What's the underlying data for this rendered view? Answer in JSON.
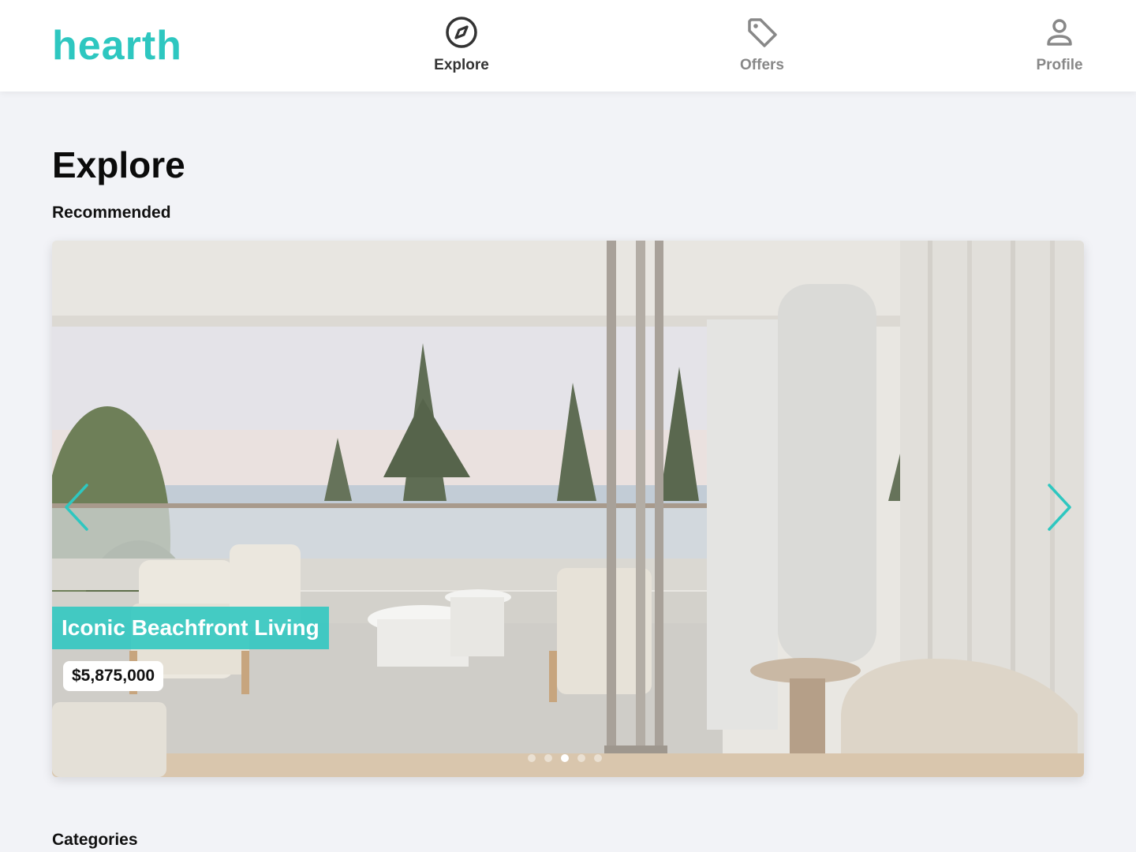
{
  "header": {
    "logo": "hearth",
    "nav": [
      {
        "label": "Explore",
        "icon": "compass-icon",
        "active": true
      },
      {
        "label": "Offers",
        "icon": "tag-icon",
        "active": false
      },
      {
        "label": "Profile",
        "icon": "user-icon",
        "active": false
      }
    ]
  },
  "main": {
    "title": "Explore",
    "recommended_heading": "Recommended",
    "categories_heading": "Categories",
    "carousel": {
      "listing_title": "Iconic Beachfront Living",
      "price": "$5,875,000",
      "slide_count": 5,
      "active_slide": 3
    }
  },
  "colors": {
    "accent": "#2ec7c0",
    "background": "#f2f3f7",
    "header": "#ffffff"
  }
}
